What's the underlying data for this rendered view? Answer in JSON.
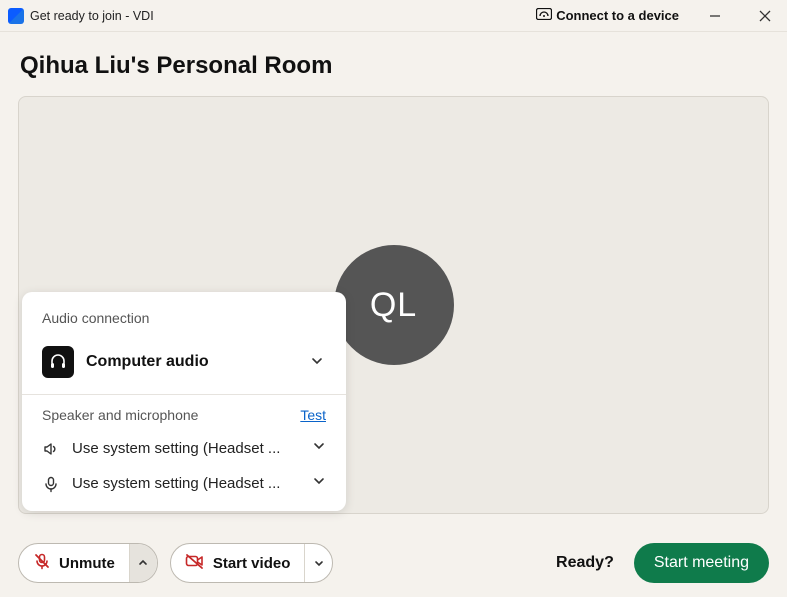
{
  "titlebar": {
    "title": "Get ready to join - VDI",
    "connect_label": "Connect to a device"
  },
  "room": {
    "title": "Qihua Liu's Personal Room",
    "avatar_initials": "QL"
  },
  "audio_popover": {
    "title": "Audio connection",
    "option_label": "Computer audio",
    "section_label": "Speaker and microphone",
    "test_label": "Test",
    "speaker_value": "Use system setting (Headset ...",
    "mic_value": "Use system setting (Headset ..."
  },
  "controls": {
    "unmute_label": "Unmute",
    "start_video_label": "Start video",
    "ready_label": "Ready?",
    "start_meeting_label": "Start meeting"
  },
  "colors": {
    "accent_green": "#0f7b4b",
    "danger_red": "#c62828"
  }
}
